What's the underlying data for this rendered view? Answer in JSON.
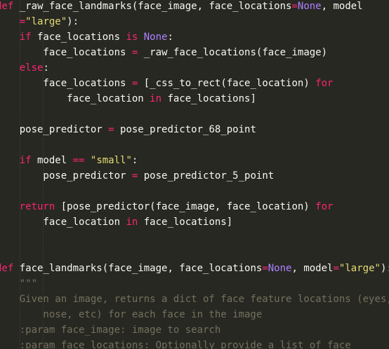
{
  "theme": {
    "background": "#272822",
    "foreground": "#f8f8f2",
    "keyword": "#f92672",
    "constant": "#ae81ff",
    "string": "#e6db74",
    "comment": "#75715e",
    "parameter": "#fd971f"
  },
  "lines": [
    [
      {
        "t": "def",
        "c": "kw"
      },
      {
        "t": " _raw_face_landmarks(face_image, face_locations"
      },
      {
        "t": "=",
        "c": "op"
      },
      {
        "t": "None",
        "c": "const"
      },
      {
        "t": ", model"
      }
    ],
    [
      {
        "t": "    "
      },
      {
        "t": "=",
        "c": "op"
      },
      {
        "t": "\"large\"",
        "c": "str"
      },
      {
        "t": "):"
      }
    ],
    [
      {
        "t": "    "
      },
      {
        "t": "if",
        "c": "kw"
      },
      {
        "t": " face_locations "
      },
      {
        "t": "is",
        "c": "kw"
      },
      {
        "t": " "
      },
      {
        "t": "None",
        "c": "const"
      },
      {
        "t": ":"
      }
    ],
    [
      {
        "t": "        face_locations "
      },
      {
        "t": "=",
        "c": "op"
      },
      {
        "t": " _raw_face_locations(face_image)"
      }
    ],
    [
      {
        "t": "    "
      },
      {
        "t": "else",
        "c": "kw"
      },
      {
        "t": ":"
      }
    ],
    [
      {
        "t": "        face_locations "
      },
      {
        "t": "=",
        "c": "op"
      },
      {
        "t": " [_css_to_rect(face_location) "
      },
      {
        "t": "for",
        "c": "kw"
      }
    ],
    [
      {
        "t": "            face_location "
      },
      {
        "t": "in",
        "c": "kw"
      },
      {
        "t": " face_locations]"
      }
    ],
    [
      {
        "t": ""
      }
    ],
    [
      {
        "t": "    pose_predictor "
      },
      {
        "t": "=",
        "c": "op"
      },
      {
        "t": " pose_predictor_68_point"
      }
    ],
    [
      {
        "t": ""
      }
    ],
    [
      {
        "t": "    "
      },
      {
        "t": "if",
        "c": "kw"
      },
      {
        "t": " model "
      },
      {
        "t": "==",
        "c": "op"
      },
      {
        "t": " "
      },
      {
        "t": "\"small\"",
        "c": "str"
      },
      {
        "t": ":"
      }
    ],
    [
      {
        "t": "        pose_predictor "
      },
      {
        "t": "=",
        "c": "op"
      },
      {
        "t": " pose_predictor_5_point"
      }
    ],
    [
      {
        "t": ""
      }
    ],
    [
      {
        "t": "    "
      },
      {
        "t": "return",
        "c": "kw"
      },
      {
        "t": " [pose_predictor(face_image, face_location) "
      },
      {
        "t": "for",
        "c": "kw"
      }
    ],
    [
      {
        "t": "        face_location "
      },
      {
        "t": "in",
        "c": "kw"
      },
      {
        "t": " face_locations]"
      }
    ],
    [
      {
        "t": ""
      }
    ],
    [
      {
        "t": ""
      }
    ],
    [
      {
        "t": "def",
        "c": "kw"
      },
      {
        "t": " face_landmarks(face_image, face_locations"
      },
      {
        "t": "=",
        "c": "op"
      },
      {
        "t": "None",
        "c": "const"
      },
      {
        "t": ", model"
      },
      {
        "t": "=",
        "c": "op"
      },
      {
        "t": "\"large\"",
        "c": "str"
      },
      {
        "t": "):"
      }
    ],
    [
      {
        "t": "    "
      },
      {
        "t": "\"\"\"",
        "c": "cmt"
      }
    ],
    [
      {
        "t": "    Given an image, returns a dict of face feature locations (eyes,",
        "c": "cmt"
      }
    ],
    [
      {
        "t": "        nose, etc) for each face in the image",
        "c": "cmt"
      }
    ],
    [
      {
        "t": "    :param face_image: image to search",
        "c": "cmt"
      }
    ],
    [
      {
        "t": "    :param face_locations: Optionally provide a list of face",
        "c": "cmt"
      }
    ]
  ]
}
